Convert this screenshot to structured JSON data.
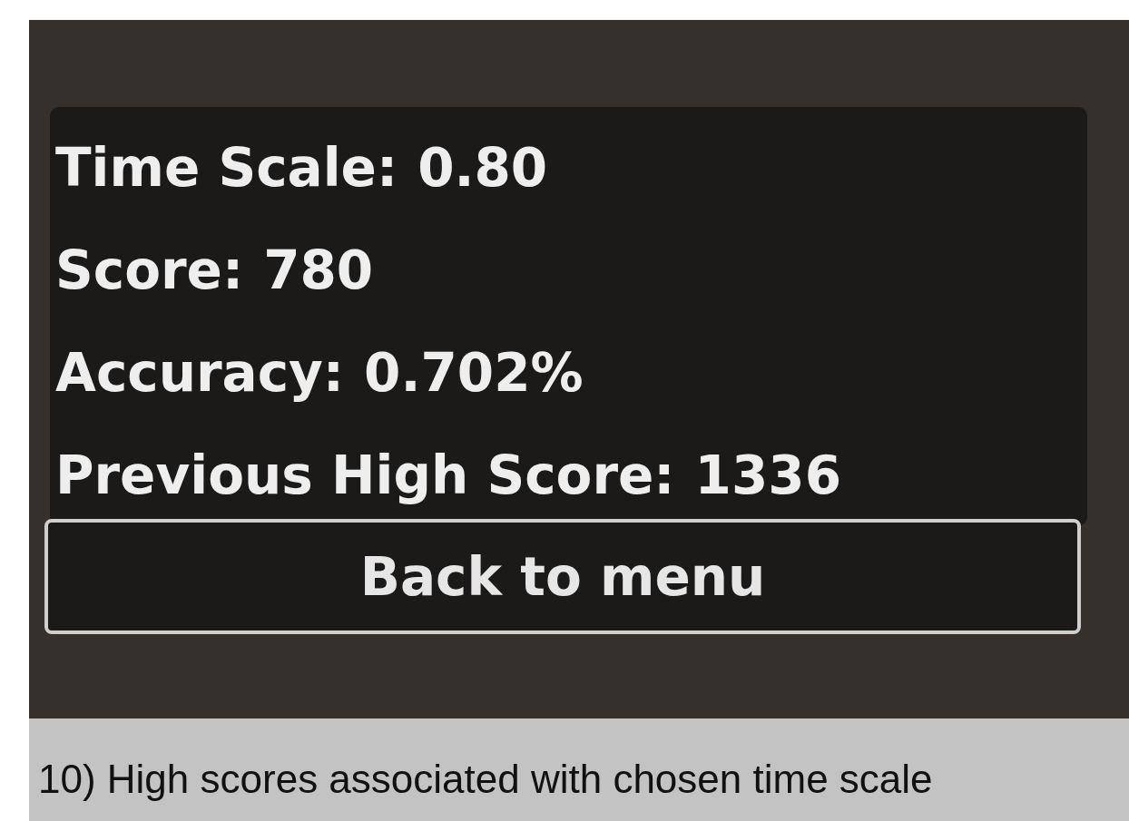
{
  "results": {
    "stats": [
      {
        "label": "Time Scale:",
        "value": "0.80"
      },
      {
        "label": "Score:",
        "value": "780"
      },
      {
        "label": "Accuracy:",
        "value": "0.702%"
      },
      {
        "label": "Previous High Score:",
        "value": "1336"
      }
    ],
    "button": "Back to menu"
  },
  "caption": "10) High scores associated with chosen time scale"
}
